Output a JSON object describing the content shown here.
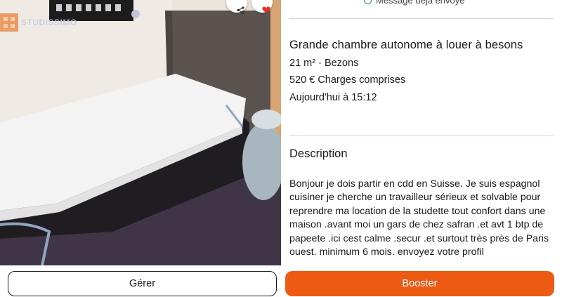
{
  "photo": {
    "watermark_text": "STUDISSIMO",
    "share_icon": "share-icon",
    "favorite_icon": "heart-icon"
  },
  "listing": {
    "status_text": "Message déjà envoyé",
    "title": "Grande chambre autonome à louer à besons",
    "surface_location": "21 m² · Bezons",
    "price": "520 € Charges comprises",
    "posted": "Aujourd'hui à 15:12",
    "description_heading": "Description",
    "description": "Bonjour je dois partir en cdd en Suisse. Je suis espagnol  cuisiner  je cherche un travailleur sérieux et solvable pour reprendre  ma location  de la studette tout confort dans une maison .avant moi un gars de chez safran .et avt 1 btp de papeete .ici cest calme .secur .et surtout très près de Paris ouest. minimum 6 mois. envoyez votre profil"
  },
  "actions": {
    "manage_label": "Gérer",
    "boost_label": "Booster"
  },
  "colors": {
    "accent": "#ec5a13",
    "divider": "#d9d2c9",
    "sent_icon": "#3a8a5a"
  }
}
